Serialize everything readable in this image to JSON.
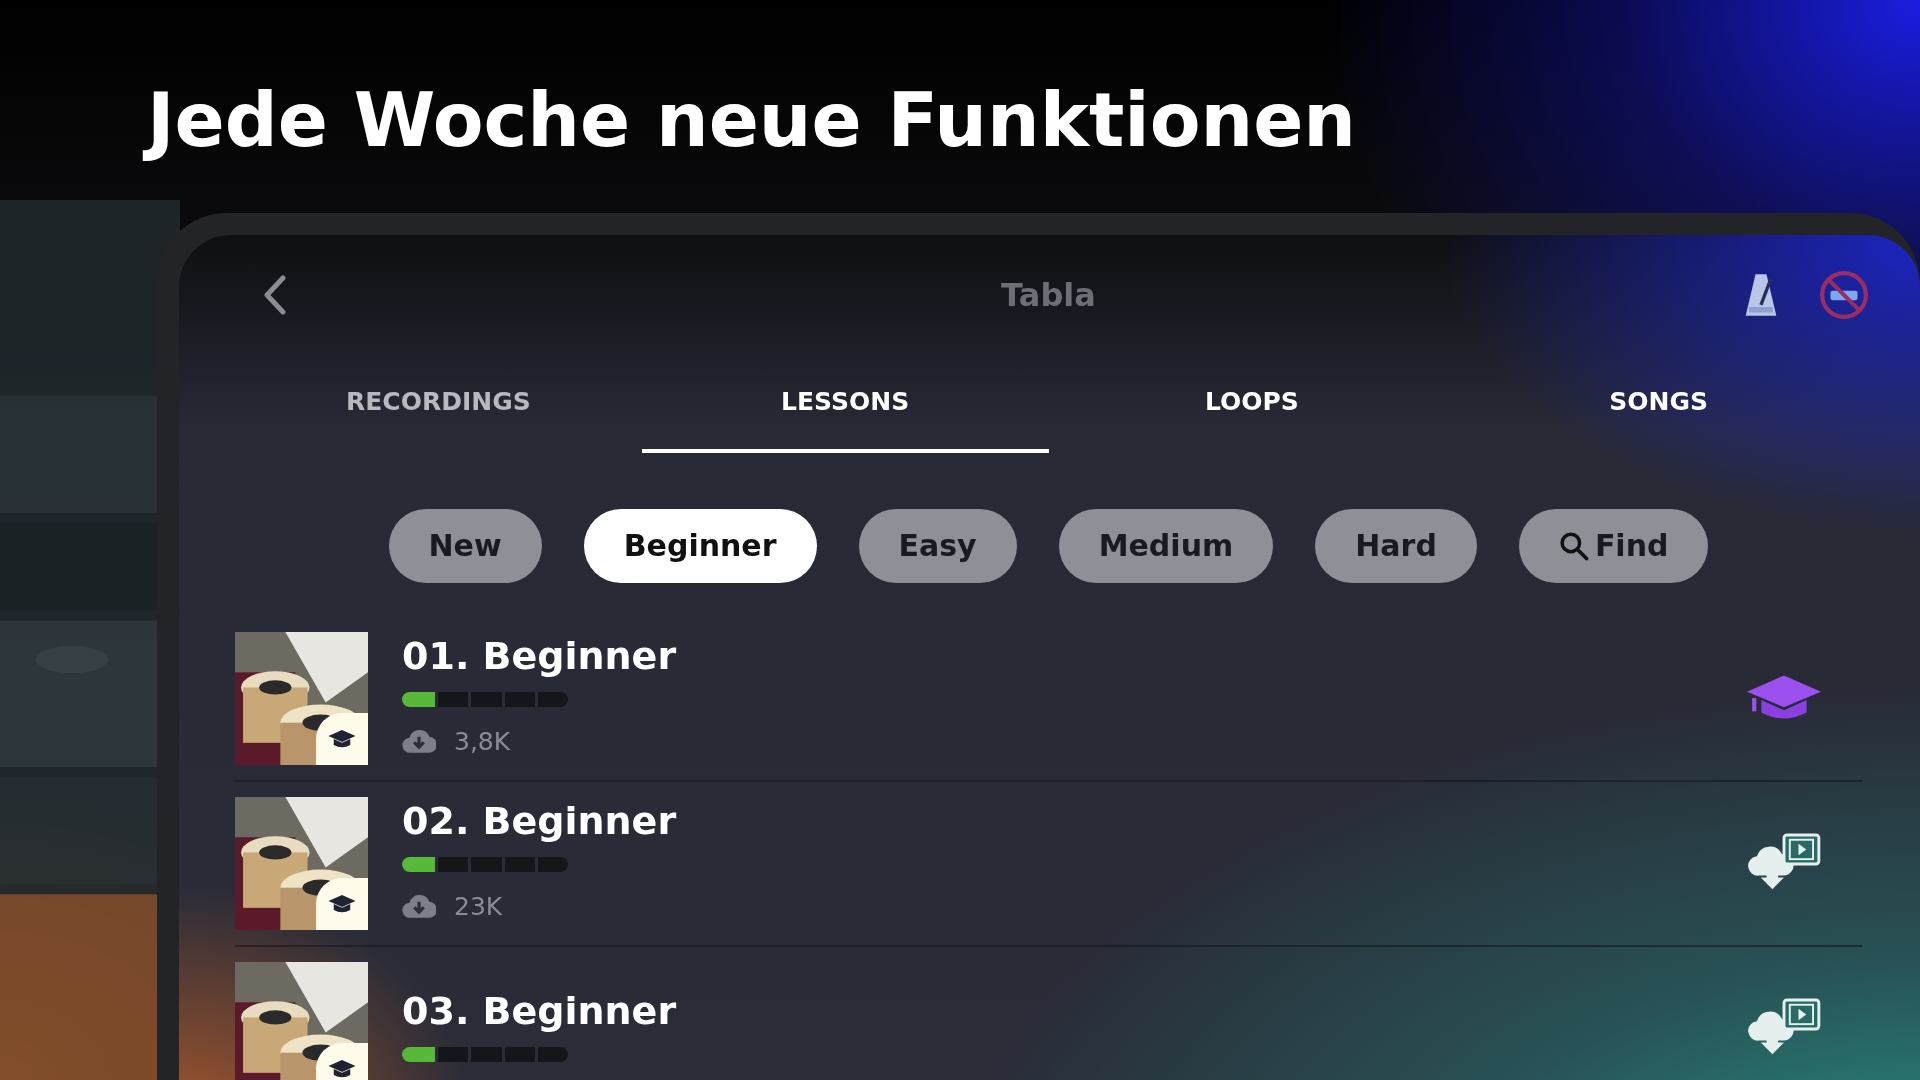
{
  "headline": "Jede Woche neue Funktionen",
  "screen": {
    "title": "Tabla",
    "tabs": [
      {
        "label": "RECORDINGS",
        "selected": false
      },
      {
        "label": "LESSONS",
        "selected": true
      },
      {
        "label": "LOOPS",
        "selected": false
      },
      {
        "label": "SONGS",
        "selected": false
      }
    ],
    "filters": [
      {
        "label": "New",
        "selected": false,
        "kind": "text"
      },
      {
        "label": "Beginner",
        "selected": true,
        "kind": "text"
      },
      {
        "label": "Easy",
        "selected": false,
        "kind": "text"
      },
      {
        "label": "Medium",
        "selected": false,
        "kind": "text"
      },
      {
        "label": "Hard",
        "selected": false,
        "kind": "text"
      },
      {
        "label": "Find",
        "selected": false,
        "kind": "search"
      }
    ],
    "lessons": [
      {
        "title": "01. Beginner",
        "level": 0.2,
        "downloads": "3,8K",
        "kind": "lesson"
      },
      {
        "title": "02. Beginner",
        "level": 0.2,
        "downloads": "23K",
        "kind": "download"
      },
      {
        "title": "03. Beginner",
        "level": 0.2,
        "kind": "download"
      }
    ]
  }
}
